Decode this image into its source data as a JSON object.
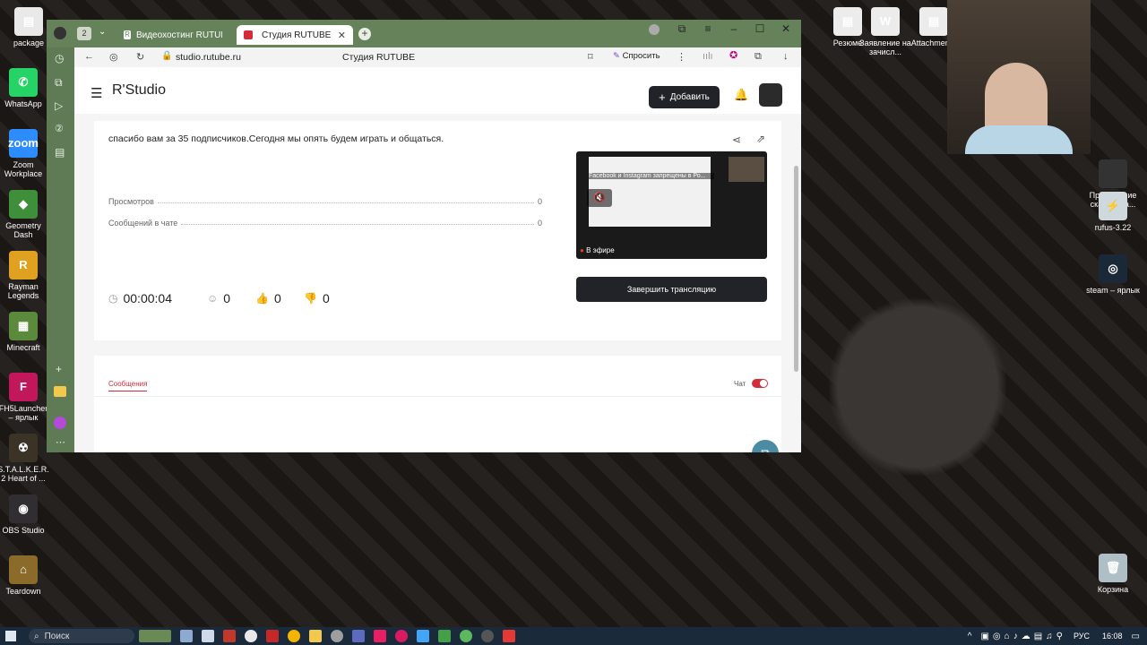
{
  "desktop": {
    "left_icons": [
      {
        "label": "package",
        "color": "#e9e9e9",
        "glyph": "▤"
      },
      {
        "label": "WhatsApp",
        "color": "#25d366",
        "glyph": "✆"
      },
      {
        "label": "Zoom Workplace",
        "color": "#2d8cff",
        "glyph": "zoom"
      },
      {
        "label": "Geometry Dash",
        "color": "#3f8f3a",
        "glyph": "◆"
      },
      {
        "label": "Rayman Legends",
        "color": "#e0a020",
        "glyph": "R"
      },
      {
        "label": "Minecraft",
        "color": "#5b8a3c",
        "glyph": "▦"
      },
      {
        "label": "FH5Launcher – ярлык",
        "color": "#c2185b",
        "glyph": "F"
      },
      {
        "label": "S.T.A.L.K.E.R. 2 Heart of ...",
        "color": "#3b3326",
        "glyph": "☢"
      },
      {
        "label": "OBS Studio",
        "color": "#302e31",
        "glyph": "◉"
      },
      {
        "label": "Teardown",
        "color": "#8a6b2a",
        "glyph": "⌂"
      }
    ],
    "right_icons": [
      {
        "label": "Резюме",
        "color": "#ececec",
        "glyph": "▤"
      },
      {
        "label": "Заявление на зачисл...",
        "color": "#ececec",
        "glyph": "W"
      },
      {
        "label": "Attachmen...",
        "color": "#ececec",
        "glyph": "▤"
      },
      {
        "label": "Приложение сканирова...",
        "color": "#333",
        "glyph": ""
      },
      {
        "label": "rufus-3.22",
        "color": "#cfd8dc",
        "glyph": "⚡"
      },
      {
        "label": "steam – ярлык",
        "color": "#1b2838",
        "glyph": "◎"
      },
      {
        "label": "Корзина",
        "color": "#b0bec5",
        "glyph": "🗑"
      }
    ]
  },
  "browser": {
    "tab_count": "2",
    "tabs": [
      {
        "label": "Видеохостинг RUTUBE. С",
        "active": false
      },
      {
        "label": "Студия RUTUBE",
        "active": true
      }
    ],
    "url": "studio.rutube.ru",
    "page_title": "Студия RUTUBE",
    "ask_label": "Спросить"
  },
  "studio": {
    "logo": "R'Studio",
    "add_button": "Добавить",
    "description": "спасибо вам за 35 подписчиков.Сегодня мы опять будем играть и общаться.",
    "stats": [
      {
        "label": "Просмотров",
        "value": "0"
      },
      {
        "label": "Сообщений в чате",
        "value": "0"
      }
    ],
    "duration": "00:00:04",
    "viewers": "0",
    "likes": "0",
    "dislikes": "0",
    "live_badge": "В эфире",
    "preview_overlay_text": "Facebook и Instagram запрещены в Ро...",
    "end_stream_button": "Завершить трансляцию",
    "messages_tab": "Сообщения",
    "chat_label": "Чат",
    "chat_enabled": true
  },
  "taskbar": {
    "search_placeholder": "Поиск",
    "language": "РУС",
    "time": "16:08"
  },
  "colors": {
    "accent": "#d42c3a",
    "dark_button": "#222328",
    "tab_bar": "#65825a"
  }
}
